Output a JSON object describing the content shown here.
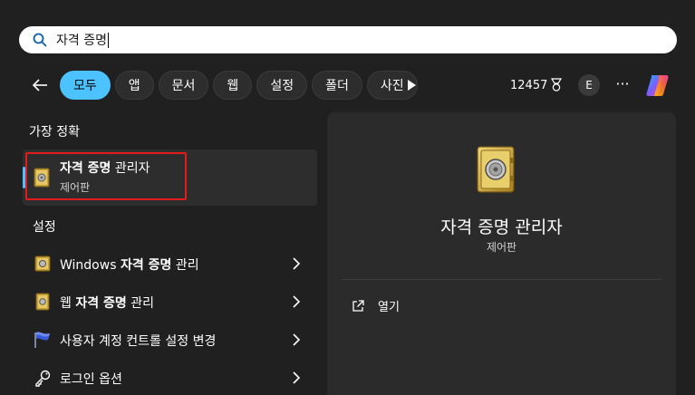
{
  "search": {
    "query": "자격 증명"
  },
  "filters": {
    "pills": [
      "모두",
      "앱",
      "문서",
      "웹",
      "설정",
      "폴더",
      "사진"
    ],
    "active_index": 0,
    "points": "12457",
    "avatar_letter": "E",
    "more": "···"
  },
  "best_match": {
    "section_title": "가장 정확",
    "title_bold": "자격 증명",
    "title_rest": " 관리자",
    "subtitle": "제어판"
  },
  "settings": {
    "section_title": "설정",
    "items": [
      {
        "pre": "Windows ",
        "bold": "자격 증명",
        "post": " 관리",
        "icon": "vault-icon"
      },
      {
        "pre": "웹 ",
        "bold": "자격 증명",
        "post": " 관리",
        "icon": "vault-icon"
      },
      {
        "pre": "사용자 계정 컨트롤 설정 변경",
        "bold": "",
        "post": "",
        "icon": "uac-flag-icon"
      },
      {
        "pre": "로그인 옵션",
        "bold": "",
        "post": "",
        "icon": "key-icon"
      }
    ]
  },
  "detail": {
    "title": "자격 증명 관리자",
    "subtitle": "제어판",
    "open_label": "열기"
  },
  "colors": {
    "accent": "#4cc2ff",
    "highlight_box": "#e21c1c",
    "background": "#202020",
    "panel": "#2b2b2b"
  }
}
